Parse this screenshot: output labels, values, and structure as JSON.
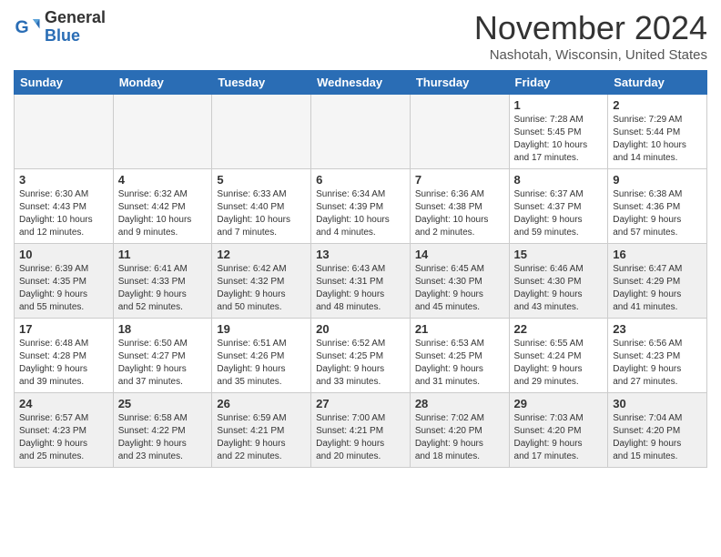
{
  "logo": {
    "general": "General",
    "blue": "Blue"
  },
  "header": {
    "month": "November 2024",
    "location": "Nashotah, Wisconsin, United States"
  },
  "weekdays": [
    "Sunday",
    "Monday",
    "Tuesday",
    "Wednesday",
    "Thursday",
    "Friday",
    "Saturday"
  ],
  "weeks": [
    [
      {
        "day": "",
        "empty": true
      },
      {
        "day": "",
        "empty": true
      },
      {
        "day": "",
        "empty": true
      },
      {
        "day": "",
        "empty": true
      },
      {
        "day": "",
        "empty": true
      },
      {
        "day": "1",
        "info": "Sunrise: 7:28 AM\nSunset: 5:45 PM\nDaylight: 10 hours\nand 17 minutes."
      },
      {
        "day": "2",
        "info": "Sunrise: 7:29 AM\nSunset: 5:44 PM\nDaylight: 10 hours\nand 14 minutes."
      }
    ],
    [
      {
        "day": "3",
        "info": "Sunrise: 6:30 AM\nSunset: 4:43 PM\nDaylight: 10 hours\nand 12 minutes."
      },
      {
        "day": "4",
        "info": "Sunrise: 6:32 AM\nSunset: 4:42 PM\nDaylight: 10 hours\nand 9 minutes."
      },
      {
        "day": "5",
        "info": "Sunrise: 6:33 AM\nSunset: 4:40 PM\nDaylight: 10 hours\nand 7 minutes."
      },
      {
        "day": "6",
        "info": "Sunrise: 6:34 AM\nSunset: 4:39 PM\nDaylight: 10 hours\nand 4 minutes."
      },
      {
        "day": "7",
        "info": "Sunrise: 6:36 AM\nSunset: 4:38 PM\nDaylight: 10 hours\nand 2 minutes."
      },
      {
        "day": "8",
        "info": "Sunrise: 6:37 AM\nSunset: 4:37 PM\nDaylight: 9 hours\nand 59 minutes."
      },
      {
        "day": "9",
        "info": "Sunrise: 6:38 AM\nSunset: 4:36 PM\nDaylight: 9 hours\nand 57 minutes."
      }
    ],
    [
      {
        "day": "10",
        "info": "Sunrise: 6:39 AM\nSunset: 4:35 PM\nDaylight: 9 hours\nand 55 minutes.",
        "shaded": true
      },
      {
        "day": "11",
        "info": "Sunrise: 6:41 AM\nSunset: 4:33 PM\nDaylight: 9 hours\nand 52 minutes.",
        "shaded": true
      },
      {
        "day": "12",
        "info": "Sunrise: 6:42 AM\nSunset: 4:32 PM\nDaylight: 9 hours\nand 50 minutes.",
        "shaded": true
      },
      {
        "day": "13",
        "info": "Sunrise: 6:43 AM\nSunset: 4:31 PM\nDaylight: 9 hours\nand 48 minutes.",
        "shaded": true
      },
      {
        "day": "14",
        "info": "Sunrise: 6:45 AM\nSunset: 4:30 PM\nDaylight: 9 hours\nand 45 minutes.",
        "shaded": true
      },
      {
        "day": "15",
        "info": "Sunrise: 6:46 AM\nSunset: 4:30 PM\nDaylight: 9 hours\nand 43 minutes.",
        "shaded": true
      },
      {
        "day": "16",
        "info": "Sunrise: 6:47 AM\nSunset: 4:29 PM\nDaylight: 9 hours\nand 41 minutes.",
        "shaded": true
      }
    ],
    [
      {
        "day": "17",
        "info": "Sunrise: 6:48 AM\nSunset: 4:28 PM\nDaylight: 9 hours\nand 39 minutes."
      },
      {
        "day": "18",
        "info": "Sunrise: 6:50 AM\nSunset: 4:27 PM\nDaylight: 9 hours\nand 37 minutes."
      },
      {
        "day": "19",
        "info": "Sunrise: 6:51 AM\nSunset: 4:26 PM\nDaylight: 9 hours\nand 35 minutes."
      },
      {
        "day": "20",
        "info": "Sunrise: 6:52 AM\nSunset: 4:25 PM\nDaylight: 9 hours\nand 33 minutes."
      },
      {
        "day": "21",
        "info": "Sunrise: 6:53 AM\nSunset: 4:25 PM\nDaylight: 9 hours\nand 31 minutes."
      },
      {
        "day": "22",
        "info": "Sunrise: 6:55 AM\nSunset: 4:24 PM\nDaylight: 9 hours\nand 29 minutes."
      },
      {
        "day": "23",
        "info": "Sunrise: 6:56 AM\nSunset: 4:23 PM\nDaylight: 9 hours\nand 27 minutes."
      }
    ],
    [
      {
        "day": "24",
        "info": "Sunrise: 6:57 AM\nSunset: 4:23 PM\nDaylight: 9 hours\nand 25 minutes.",
        "shaded": true
      },
      {
        "day": "25",
        "info": "Sunrise: 6:58 AM\nSunset: 4:22 PM\nDaylight: 9 hours\nand 23 minutes.",
        "shaded": true
      },
      {
        "day": "26",
        "info": "Sunrise: 6:59 AM\nSunset: 4:21 PM\nDaylight: 9 hours\nand 22 minutes.",
        "shaded": true
      },
      {
        "day": "27",
        "info": "Sunrise: 7:00 AM\nSunset: 4:21 PM\nDaylight: 9 hours\nand 20 minutes.",
        "shaded": true
      },
      {
        "day": "28",
        "info": "Sunrise: 7:02 AM\nSunset: 4:20 PM\nDaylight: 9 hours\nand 18 minutes.",
        "shaded": true
      },
      {
        "day": "29",
        "info": "Sunrise: 7:03 AM\nSunset: 4:20 PM\nDaylight: 9 hours\nand 17 minutes.",
        "shaded": true
      },
      {
        "day": "30",
        "info": "Sunrise: 7:04 AM\nSunset: 4:20 PM\nDaylight: 9 hours\nand 15 minutes.",
        "shaded": true
      }
    ]
  ]
}
